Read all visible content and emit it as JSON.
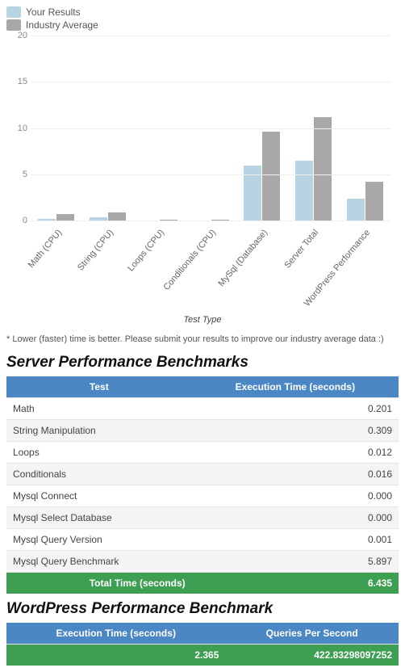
{
  "legend": {
    "series1": {
      "label": "Your Results",
      "color": "#b8d4e3"
    },
    "series2": {
      "label": "Industry Average",
      "color": "#a8a8a8"
    }
  },
  "chart_data": {
    "type": "bar",
    "title": "",
    "xlabel": "Test Type",
    "ylabel": "",
    "ylim": [
      0,
      20
    ],
    "yticks": [
      0,
      5,
      10,
      15,
      20
    ],
    "categories": [
      "Math (CPU)",
      "String (CPU)",
      "Loops (CPU)",
      "Conditionals (CPU)",
      "MySql (Database)",
      "Server Total",
      "WordPress Performance"
    ],
    "series": [
      {
        "name": "Your Results",
        "color": "#b8d4e3",
        "values": [
          0.2,
          0.31,
          0.01,
          0.02,
          5.9,
          6.44,
          2.37
        ]
      },
      {
        "name": "Industry Average",
        "color": "#a8a8a8",
        "values": [
          0.7,
          0.9,
          0.1,
          0.1,
          9.6,
          11.2,
          4.2
        ]
      }
    ]
  },
  "footnote": "* Lower (faster) time is better. Please submit your results to improve our industry average data :)",
  "server_table": {
    "title": "Server Performance Benchmarks",
    "headers": {
      "test": "Test",
      "time": "Execution Time (seconds)"
    },
    "rows": [
      {
        "test": "Math",
        "time": "0.201"
      },
      {
        "test": "String Manipulation",
        "time": "0.309"
      },
      {
        "test": "Loops",
        "time": "0.012"
      },
      {
        "test": "Conditionals",
        "time": "0.016"
      },
      {
        "test": "Mysql Connect",
        "time": "0.000"
      },
      {
        "test": "Mysql Select Database",
        "time": "0.000"
      },
      {
        "test": "Mysql Query Version",
        "time": "0.001"
      },
      {
        "test": "Mysql Query Benchmark",
        "time": "5.897"
      }
    ],
    "total": {
      "label": "Total Time (seconds)",
      "value": "6.435"
    }
  },
  "wp_table": {
    "title": "WordPress Performance Benchmark",
    "headers": {
      "time": "Execution Time (seconds)",
      "qps": "Queries Per Second"
    },
    "row": {
      "time": "2.365",
      "qps": "422.83298097252"
    }
  }
}
